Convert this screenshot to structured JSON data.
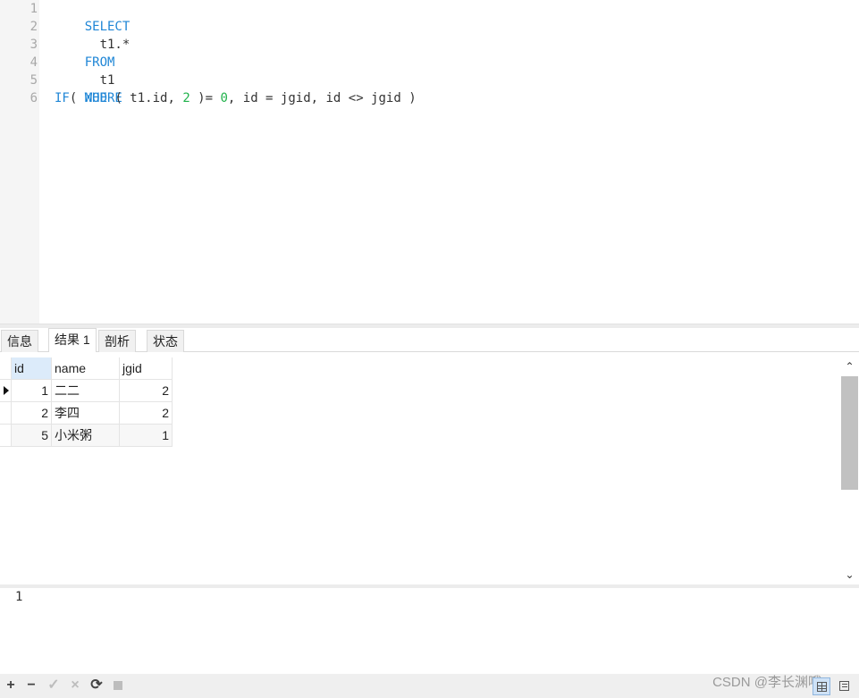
{
  "editor": {
    "line_numbers": [
      "1",
      "2",
      "3",
      "4",
      "5",
      "6"
    ],
    "lines": [
      [
        {
          "t": "SELECT",
          "c": "kw"
        }
      ],
      [
        {
          "t": "  t1.*",
          "c": ""
        }
      ],
      [
        {
          "t": "FROM",
          "c": "kw"
        }
      ],
      [
        {
          "t": "  t1",
          "c": ""
        }
      ],
      [
        {
          "t": "WHERE",
          "c": "kw"
        }
      ],
      [
        {
          "t": "IF",
          "c": "kw"
        },
        {
          "t": "( ",
          "c": ""
        },
        {
          "t": "MOD",
          "c": "kw"
        },
        {
          "t": " ( t1.id, ",
          "c": ""
        },
        {
          "t": "2",
          "c": "num"
        },
        {
          "t": " )= ",
          "c": ""
        },
        {
          "t": "0",
          "c": "num"
        },
        {
          "t": ", id = jgid, id <> jgid )",
          "c": ""
        }
      ]
    ]
  },
  "tabs": [
    {
      "label": "信息",
      "active": false
    },
    {
      "label": "结果 1",
      "active": true
    },
    {
      "label": "剖析",
      "active": false
    },
    {
      "label": "状态",
      "active": false
    }
  ],
  "results": {
    "columns": [
      "id",
      "name",
      "jgid"
    ],
    "rows": [
      {
        "id": "1",
        "name": "二二",
        "jgid": "2"
      },
      {
        "id": "2",
        "name": "李四",
        "jgid": "2"
      },
      {
        "id": "5",
        "name": "小米粥",
        "jgid": "1"
      }
    ]
  },
  "bottom_value": "1",
  "toolbar": {
    "add_icon": "plus-icon",
    "delete_icon": "minus-icon",
    "apply_icon": "check-icon",
    "discard_icon": "x-icon",
    "refresh_icon": "refresh-icon",
    "stop_icon": "stop-icon"
  },
  "watermark": "CSDN @李长渊哦",
  "colors": {
    "keyword": "#1f86d6",
    "number": "#21b24b",
    "header_selected": "#dcebfa"
  }
}
